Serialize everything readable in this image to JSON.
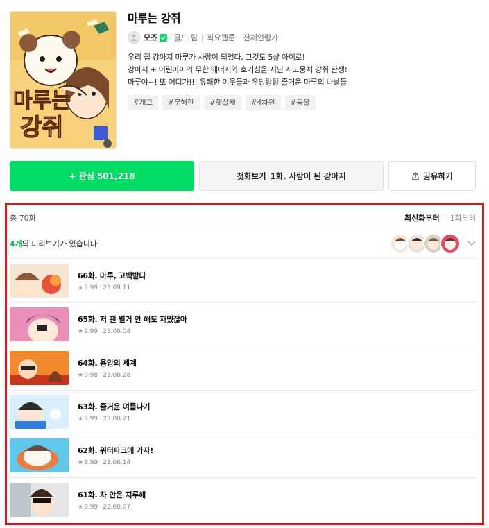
{
  "webtoon": {
    "title": "마루는 강쥐",
    "author": "모죠",
    "role": "글/그림",
    "schedule": "화요웹툰",
    "rating": "전체연령가",
    "description": [
      "우리 집 강아지 마루가 사람이 되었다, 그것도 5살 아이로!",
      "강아지 + 어린아이의 무한 에너지와 호기심을 지닌 사고뭉치 강쥐 탄생!",
      "마루야~! 또 어디가!!! 유쾌한 이웃들과 우당탕탕 즐거운 마루의 나날들"
    ],
    "tags": [
      "#개그",
      "#무해한",
      "#햇살캐",
      "#4차원",
      "#동물"
    ]
  },
  "actions": {
    "favorite_label": "+ 관심 501,218",
    "first_label": "첫화보기",
    "first_episode": "1화. 사람이 된 강아지",
    "share_label": "공유하기"
  },
  "list": {
    "total": "총 70화",
    "sort_latest": "최신화부터",
    "sort_first": "1화부터",
    "preview_count": "4개",
    "preview_text": "의 미리보기가 있습니다"
  },
  "episodes": [
    {
      "title": "66화. 마루, 고백받다",
      "rating": "9.99",
      "date": "23.09.11"
    },
    {
      "title": "65화. 저 땐 별거 안 해도 재밌잖아",
      "rating": "9.99",
      "date": "23.09.04"
    },
    {
      "title": "64화. 용암의 세계",
      "rating": "9.98",
      "date": "23.08.28"
    },
    {
      "title": "63화. 즐거운 여름나기",
      "rating": "9.99",
      "date": "23.08.21"
    },
    {
      "title": "62화. 워터파크에 가자!",
      "rating": "9.99",
      "date": "23.08.14"
    },
    {
      "title": "61화. 차 안은 지루해",
      "rating": "9.99",
      "date": "23.08.07"
    }
  ],
  "colors": {
    "accent": "#00dc64",
    "highlight_frame": "#d8191c"
  }
}
